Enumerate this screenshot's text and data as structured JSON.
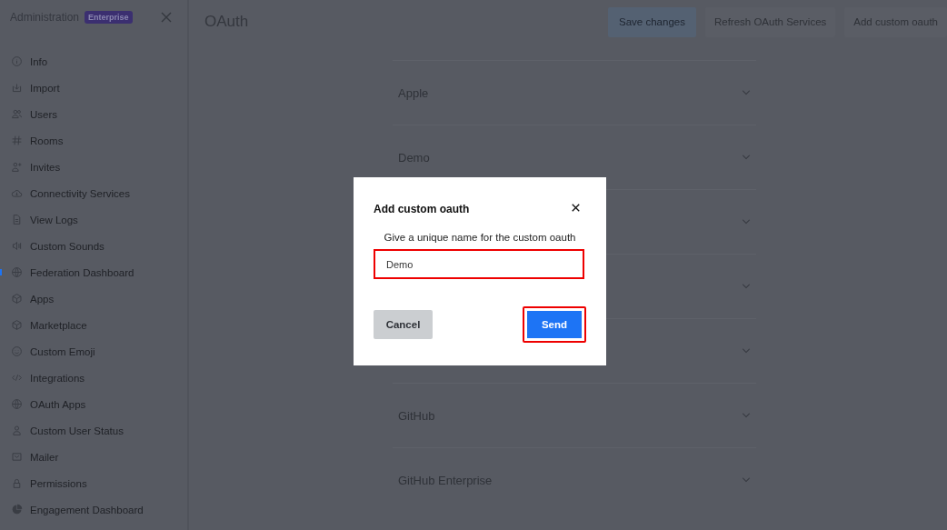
{
  "sidebar": {
    "title": "Administration",
    "badge": "Enterprise",
    "items": [
      {
        "label": "Info",
        "selected": false
      },
      {
        "label": "Import",
        "selected": false
      },
      {
        "label": "Users",
        "selected": false
      },
      {
        "label": "Rooms",
        "selected": false
      },
      {
        "label": "Invites",
        "selected": false
      },
      {
        "label": "Connectivity Services",
        "selected": false
      },
      {
        "label": "View Logs",
        "selected": false
      },
      {
        "label": "Custom Sounds",
        "selected": false
      },
      {
        "label": "Federation Dashboard",
        "selected": true
      },
      {
        "label": "Apps",
        "selected": false
      },
      {
        "label": "Marketplace",
        "selected": false
      },
      {
        "label": "Custom Emoji",
        "selected": false
      },
      {
        "label": "Integrations",
        "selected": false
      },
      {
        "label": "OAuth Apps",
        "selected": false
      },
      {
        "label": "Custom User Status",
        "selected": false
      },
      {
        "label": "Mailer",
        "selected": false
      },
      {
        "label": "Permissions",
        "selected": false
      },
      {
        "label": "Engagement Dashboard",
        "selected": false
      }
    ]
  },
  "page": {
    "title": "OAuth",
    "buttons": [
      {
        "label": "Save changes",
        "kind": "primary",
        "disabled": true
      },
      {
        "label": "Refresh OAuth Services",
        "kind": "secondary",
        "disabled": false
      },
      {
        "label": "Add custom oauth",
        "kind": "secondary",
        "disabled": false
      }
    ]
  },
  "services": [
    {
      "title": "Apple",
      "expanded": false
    },
    {
      "title": "Demo",
      "expanded": false
    },
    {
      "expanded": false
    },
    {
      "expanded": false
    },
    {
      "expanded": false
    },
    {
      "title": "GitHub",
      "expanded": false
    },
    {
      "title": "GitHub Enterprise",
      "expanded": false
    }
  ],
  "modal": {
    "title": "Add custom oauth",
    "prompt": "Give a unique name for the custom oauth",
    "field": {
      "value": "Demo",
      "highlighted": true
    },
    "buttons": [
      {
        "label": "Cancel",
        "kind": "secondary",
        "highlighted": false
      },
      {
        "label": "Send",
        "kind": "primary",
        "highlighted": true
      }
    ]
  }
}
